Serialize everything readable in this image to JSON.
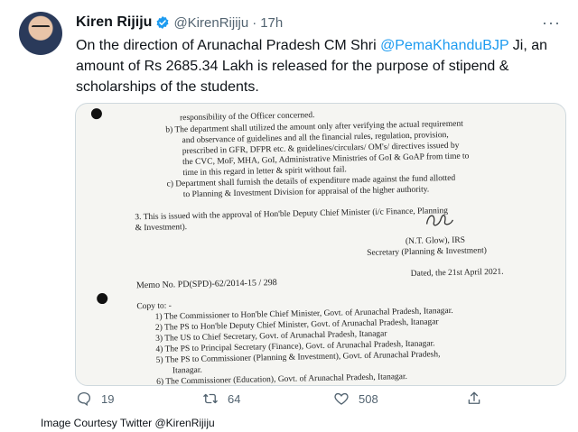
{
  "tweet": {
    "author_name": "Kiren Rijiju",
    "handle": "@KirenRijiju",
    "separator": "·",
    "time": "17h",
    "text_before": "On the direction of Arunachal Pradesh CM Shri ",
    "mention": "@PemaKhanduBJP",
    "text_after": " Ji, an amount of Rs 2685.34 Lakh is released for the purpose of stipend & scholarships of the students.",
    "more_label": "···"
  },
  "document": {
    "lines": [
      "responsibility of the Officer concerned.",
      "b)    The department shall utilized the amount only after verifying the actual requirement",
      "and observance of guidelines and all the financial rules, regulation, provision,",
      "prescribed in GFR, DFPR etc. & guidelines/circulars/ OM's/ directives issued by",
      "the CVC, MoF, MHA, GoI, Administrative Ministries of GoI & GoAP from time to",
      "time in this regard in letter & spirit without fail.",
      "c)    Department shall furnish the details of expenditure made against the fund allotted",
      "to Planning & Investment Division for appraisal of the higher authority.",
      "3.      This is issued with the approval of Hon'ble Deputy Chief Minister (i/c Finance, Planning",
      "& Investment).",
      "(N.T. Glow), IRS",
      "Secretary (Planning & Investment)",
      "Dated, the 21st April 2021.",
      "Memo No. PD(SPD)-62/2014-15 / 298",
      "Copy to: -",
      "1)   The Commissioner to Hon'ble Chief Minister, Govt. of Arunachal Pradesh, Itanagar.",
      "2)   The PS to Hon'ble Deputy Chief Minister, Govt. of Arunachal Pradesh, Itanagar",
      "3)   The US to Chief Secretary, Govt. of Arunachal Pradesh, Itanagar",
      "4)   The PS to Principal Secretary (Finance), Govt. of Arunachal Pradesh, Itanagar.",
      "5)   The PS to Commissioner (Planning & Investment), Govt. of Arunachal Pradesh,",
      "Itanagar.",
      "6)   The Commissioner (Education), Govt. of Arunachal Pradesh, Itanagar."
    ]
  },
  "actions": {
    "reply_count": "19",
    "retweet_count": "64",
    "like_count": "508",
    "share_label": ""
  },
  "caption": "Image Courtesy Twitter @KirenRijiju",
  "colors": {
    "mention": "#1d9bf0",
    "verified": "#1d9bf0",
    "muted": "#536471"
  }
}
